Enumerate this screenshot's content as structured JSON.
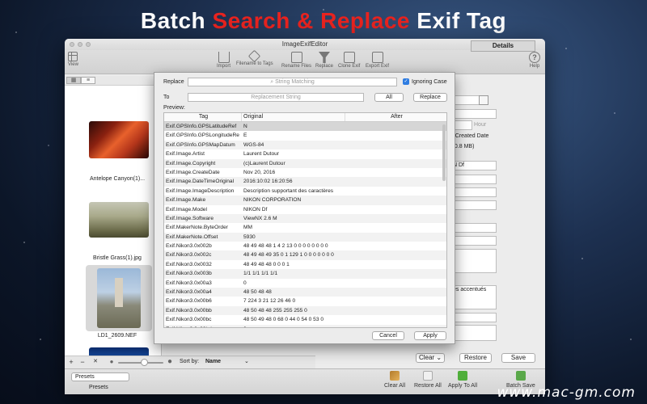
{
  "banner": {
    "part1": "Batch ",
    "part2": "Search & Replace",
    "part3": " Exif Tag"
  },
  "window": {
    "title": "ImageExifEditor"
  },
  "toolbar": {
    "view": "View",
    "import": "Import",
    "filename_to_tags": "Filename to Tags",
    "rename_files": "Rename Files",
    "replace": "Replace",
    "clone_exif": "Clone Exif",
    "export_exif": "Export Exif",
    "help": "Help"
  },
  "thumbnails": [
    {
      "caption": "Antelope Canyon(1)..."
    },
    {
      "caption": "Bristle Grass(1).jpg"
    },
    {
      "caption": "LD1_2609.NEF"
    }
  ],
  "sheet": {
    "replace_label": "Replace",
    "search_placeholder": "String Matching",
    "ignoring_case_label": "Ignoring Case",
    "to_label": "To",
    "replacement_placeholder": "Replacement String",
    "all_button": "All",
    "replace_button": "Replace",
    "preview_label": "Preview:",
    "columns": {
      "tag": "Tag",
      "original": "Original",
      "after": "After"
    },
    "rows": [
      {
        "tag": "Exif.GPSInfo.GPSLatitudeRef",
        "original": "N",
        "after": ""
      },
      {
        "tag": "Exif.GPSInfo.GPSLongitudeRe",
        "original": "E",
        "after": ""
      },
      {
        "tag": "Exif.GPSInfo.GPSMapDatum",
        "original": "WGS-84",
        "after": ""
      },
      {
        "tag": "Exif.Image.Artist",
        "original": "Laurent Dutour",
        "after": ""
      },
      {
        "tag": "Exif.Image.Copyright",
        "original": "(c)Laurent Dutour",
        "after": ""
      },
      {
        "tag": "Exif.Image.CreateDate",
        "original": "Nov 20, 2016",
        "after": ""
      },
      {
        "tag": "Exif.Image.DateTimeOriginal",
        "original": "2016:10:02 16:20:56",
        "after": ""
      },
      {
        "tag": "Exif.Image.ImageDescription",
        "original": "Description supportant des caractères",
        "after": ""
      },
      {
        "tag": "Exif.Image.Make",
        "original": "NIKON CORPORATION",
        "after": ""
      },
      {
        "tag": "Exif.Image.Model",
        "original": "NIKON Df",
        "after": ""
      },
      {
        "tag": "Exif.Image.Software",
        "original": "ViewNX 2.6 M",
        "after": ""
      },
      {
        "tag": "Exif.MakerNote.ByteOrder",
        "original": "MM",
        "after": ""
      },
      {
        "tag": "Exif.MakerNote.Offset",
        "original": "5930",
        "after": ""
      },
      {
        "tag": "Exif.Nikon3.0x002b",
        "original": "48 49 48 48 1 4 2 13 0 0 0 0 0 0 0 0",
        "after": ""
      },
      {
        "tag": "Exif.Nikon3.0x002c",
        "original": "48 49 48 49 35 0 1 129 1 0 0 0 0 0 0 0",
        "after": ""
      },
      {
        "tag": "Exif.Nikon3.0x0032",
        "original": "48 49 48 48 0 0 0 1",
        "after": ""
      },
      {
        "tag": "Exif.Nikon3.0x003b",
        "original": "1/1 1/1 1/1 1/1",
        "after": ""
      },
      {
        "tag": "Exif.Nikon3.0x00a3",
        "original": "0",
        "after": ""
      },
      {
        "tag": "Exif.Nikon3.0x00a4",
        "original": "48 50 48 48",
        "after": ""
      },
      {
        "tag": "Exif.Nikon3.0x00b6",
        "original": "7 224 3 21 12 26 46 0",
        "after": ""
      },
      {
        "tag": "Exif.Nikon3.0x00bb",
        "original": "48 50 48 48 255 255 255 0",
        "after": ""
      },
      {
        "tag": "Exif.Nikon3.0x00bc",
        "original": "48 50 49 48 0 68 0 44 0 54 0 53 0",
        "after": ""
      },
      {
        "tag": "Exif.Nikon3.0x00bd",
        "original": "0",
        "after": ""
      }
    ],
    "cancel_button": "Cancel",
    "apply_button": "Apply"
  },
  "right": {
    "details_tab": "Details",
    "hour_placeholder": "Hour",
    "files_created_date": "'s Created Date",
    "size_text": "20.8 MB)",
    "model_value": "N Df",
    "desc_fragment": "es accentués",
    "clear_button": "Clear",
    "restore_button": "Restore",
    "save_button": "Save"
  },
  "leftbar": {
    "sort_by_label": "Sort by:",
    "sort_value": "Name"
  },
  "bottom": {
    "presets_dropdown": "Presets",
    "presets_label": "Presets",
    "clear_all": "Clear All",
    "restore_all": "Restore All",
    "apply_to_all": "Apply To All",
    "batch_save": "Batch Save"
  },
  "watermark": "www.mac-gm.com"
}
